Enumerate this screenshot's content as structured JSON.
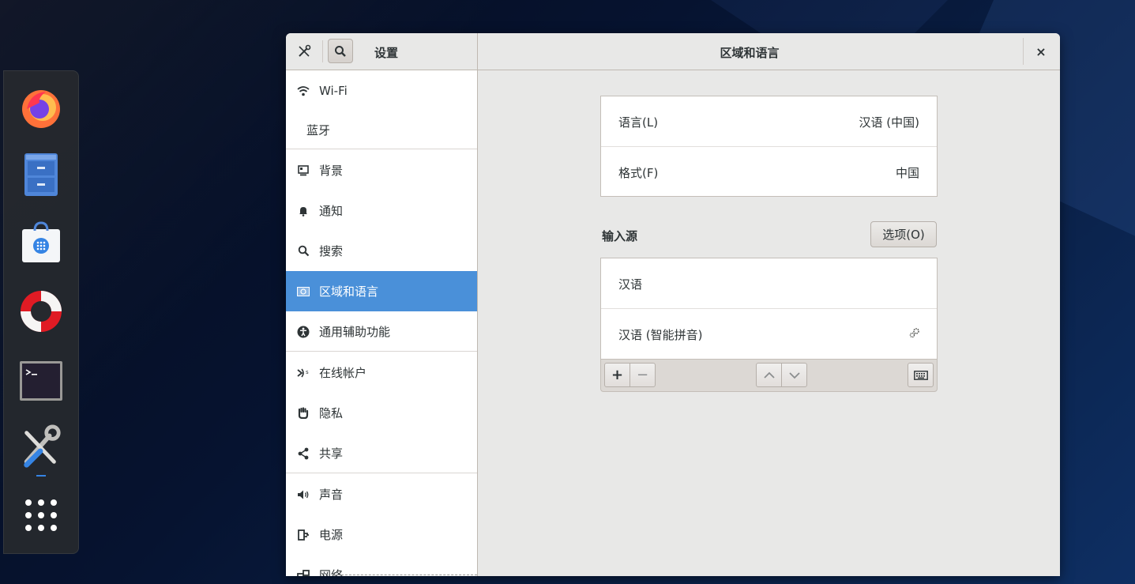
{
  "header": {
    "settings_title": "设置",
    "page_title": "区域和语言",
    "close_label": "×"
  },
  "sidebar": {
    "items": [
      {
        "label": "Wi-Fi",
        "icon": "wifi-icon"
      },
      {
        "label": "蓝牙",
        "icon": ""
      },
      {
        "label": "背景",
        "icon": "background-icon"
      },
      {
        "label": "通知",
        "icon": "bell-icon"
      },
      {
        "label": "搜索",
        "icon": "search-icon"
      },
      {
        "label": "区域和语言",
        "icon": "region-icon",
        "active": true
      },
      {
        "label": "通用辅助功能",
        "icon": "accessibility-icon"
      },
      {
        "label": "在线帐户",
        "icon": "online-accounts-icon"
      },
      {
        "label": "隐私",
        "icon": "hand-icon"
      },
      {
        "label": "共享",
        "icon": "share-icon"
      },
      {
        "label": "声音",
        "icon": "speaker-icon"
      },
      {
        "label": "电源",
        "icon": "power-icon"
      },
      {
        "label": "网络",
        "icon": "network-icon"
      }
    ]
  },
  "language_panel": {
    "rows": [
      {
        "key": "语言(L)",
        "value": "汉语 (中国)"
      },
      {
        "key": "格式(F)",
        "value": "中国"
      }
    ]
  },
  "input_sources": {
    "title": "输入源",
    "options_label": "选项(O)",
    "items": [
      {
        "label": "汉语"
      },
      {
        "label": "汉语 (智能拼音)",
        "has_settings": true
      }
    ],
    "toolbar": {
      "add_label": "+",
      "remove_label": "−"
    }
  },
  "dock": {
    "items": [
      "firefox-icon",
      "file-cabinet-icon",
      "software-store-icon",
      "help-lifebuoy-icon",
      "terminal-icon",
      "settings-tools-icon",
      "app-grid-icon"
    ]
  },
  "colors": {
    "accent": "#4a90d9",
    "window_bg": "#e8e8e7",
    "dock_bg": "#26292e"
  }
}
